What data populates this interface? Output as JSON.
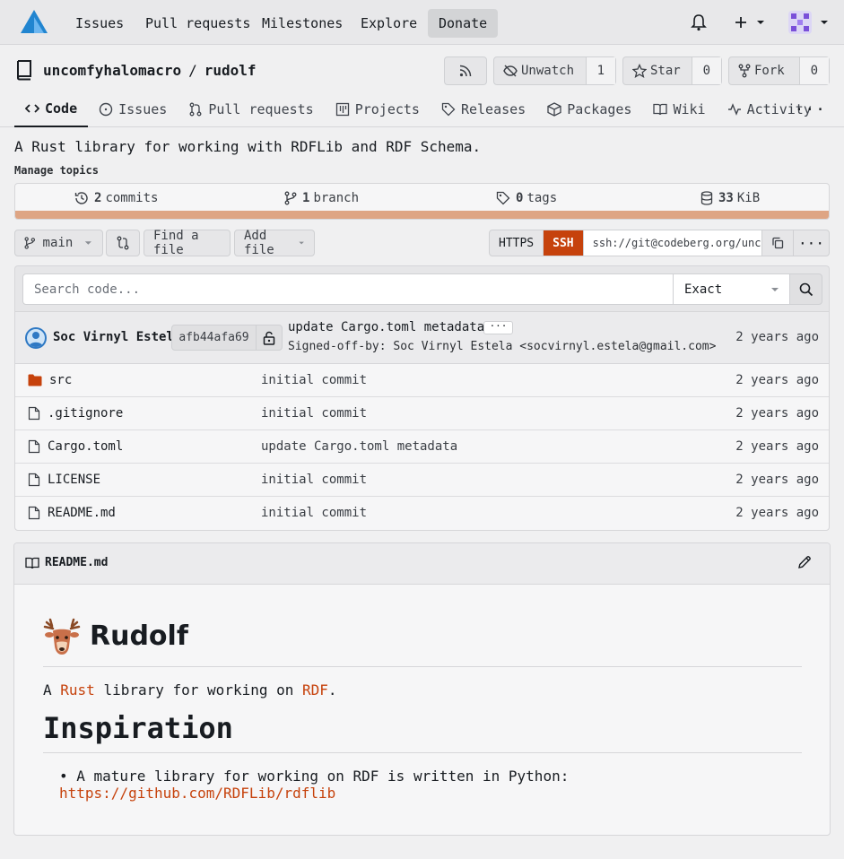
{
  "nav": {
    "items": [
      "Issues",
      "Pull requests",
      "Milestones",
      "Explore"
    ],
    "donate": "Donate"
  },
  "repo": {
    "owner": "uncomfyhalomacro",
    "separator": "/",
    "name": "rudolf",
    "unwatch_label": "Unwatch",
    "watch_count": "1",
    "star_label": "Star",
    "star_count": "0",
    "fork_label": "Fork",
    "fork_count": "0"
  },
  "tabs": [
    "Code",
    "Issues",
    "Pull requests",
    "Projects",
    "Releases",
    "Packages",
    "Wiki",
    "Activity"
  ],
  "description": "A Rust library for working with RDFLib and RDF Schema.",
  "manage_topics": "Manage topics",
  "stats": {
    "commits_num": "2",
    "commits_label": "commits",
    "branch_num": "1",
    "branch_label": "branch",
    "tags_num": "0",
    "tags_label": "tags",
    "size_num": "33",
    "size_label": "KiB",
    "lang_color": "#dea584"
  },
  "toolbar": {
    "branch": "main",
    "find_file": "Find a file",
    "add_file": "Add file",
    "https": "HTTPS",
    "ssh": "SSH",
    "clone_url": "ssh://git@codeberg.org/uncomfyhalomacro/rudolf.git"
  },
  "search": {
    "placeholder": "Search code...",
    "mode": "Exact"
  },
  "latest_commit": {
    "author": "Soc Virnyl Estela",
    "sha": "afb44afa69",
    "message": "update Cargo.toml metadata",
    "ellipsis": "···",
    "signoff": "Signed-off-by: Soc Virnyl Estela <socvirnyl.estela@gmail.com>",
    "time": "2 years ago"
  },
  "files": [
    {
      "name": "src",
      "type": "folder",
      "message": "initial commit",
      "time": "2 years ago"
    },
    {
      "name": ".gitignore",
      "type": "file",
      "message": "initial commit",
      "time": "2 years ago"
    },
    {
      "name": "Cargo.toml",
      "type": "file",
      "message": "update Cargo.toml metadata",
      "time": "2 years ago"
    },
    {
      "name": "LICENSE",
      "type": "file",
      "message": "initial commit",
      "time": "2 years ago"
    },
    {
      "name": "README.md",
      "type": "file",
      "message": "initial commit",
      "time": "2 years ago"
    }
  ],
  "readme": {
    "filename": "README.md",
    "title": "Rudolf",
    "intro_a": "A",
    "intro_rust": "Rust",
    "intro_mid": "library for working on",
    "intro_rdf": "RDF",
    "intro_end": ".",
    "h2": "Inspiration",
    "bullet_text": "A mature library for working on RDF is written in Python:",
    "bullet_link": "https://github.com/RDFLib/rdflib"
  },
  "colors": {
    "accent": "#c6420c",
    "logo_blue": "#2185d0"
  }
}
